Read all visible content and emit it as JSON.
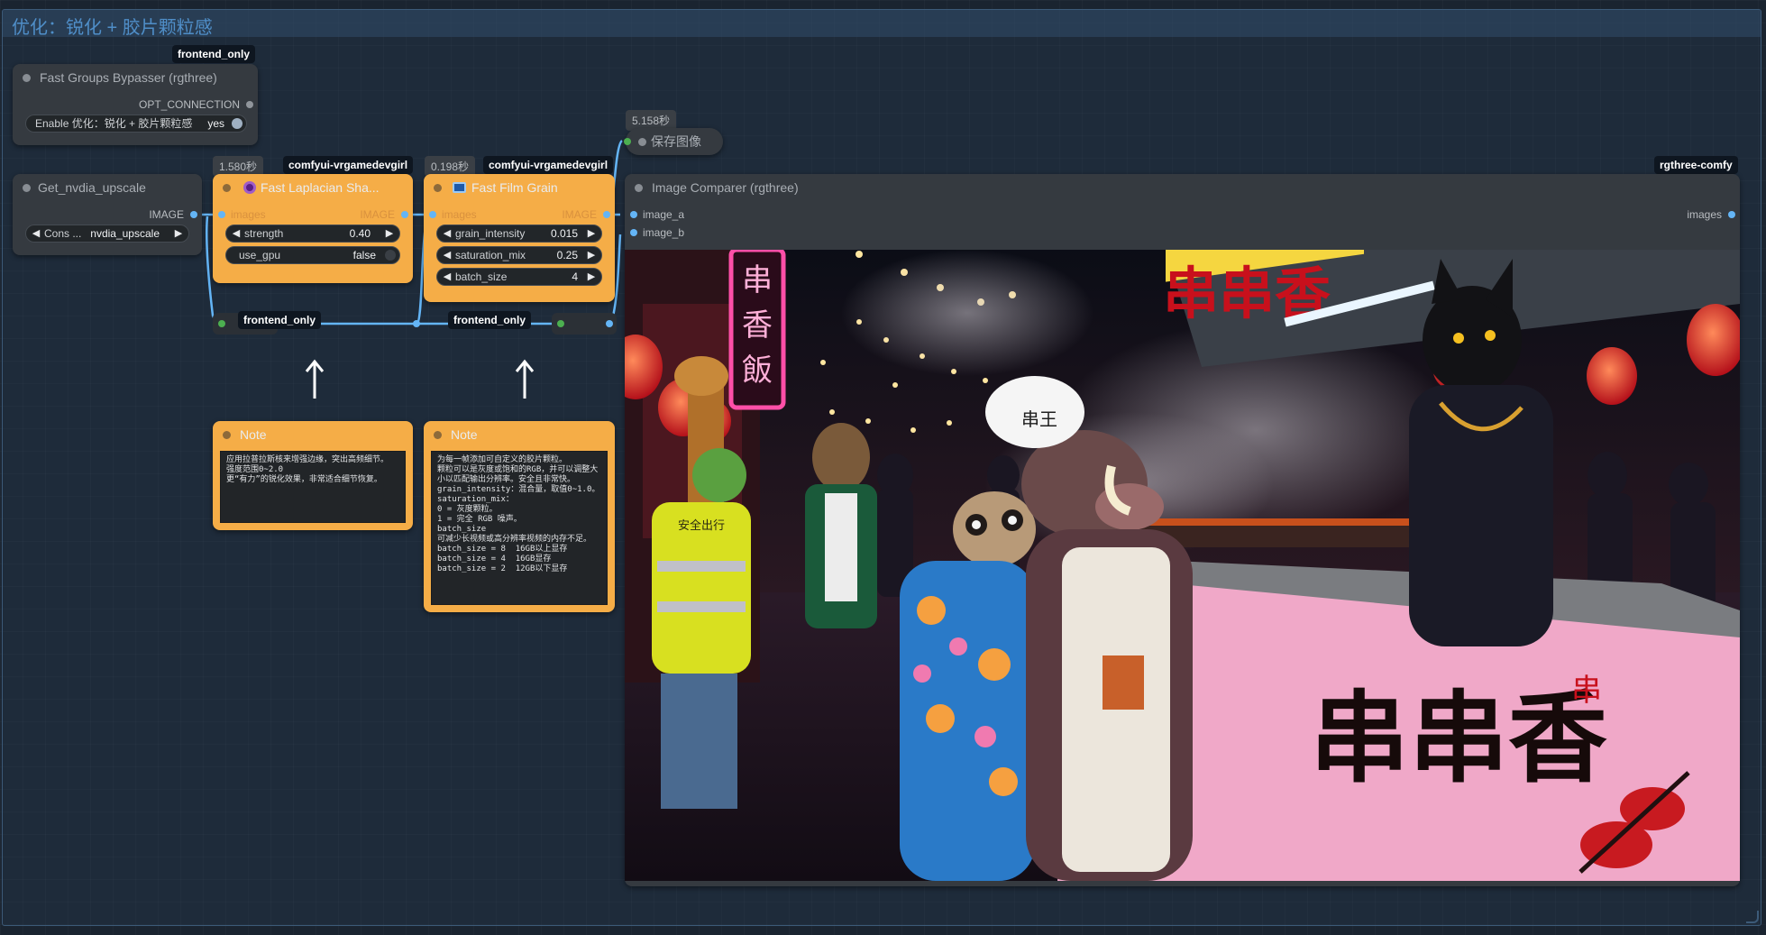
{
  "group": {
    "title": "优化：锐化 + 胶片颗粒感"
  },
  "badges": {
    "bypasser": "frontend_only",
    "laplacian_source": "comfyui-vrgamedevgirl",
    "laplacian_time": "1.580秒",
    "filmgrain_source": "comfyui-vrgamedevgirl",
    "filmgrain_time": "0.198秒",
    "save_time": "5.158秒",
    "comparer_source": "rgthree-comfy",
    "reroute_1": "frontend_only",
    "reroute_2": "frontend_only"
  },
  "bypasser": {
    "title": "Fast Groups Bypasser (rgthree)",
    "output": "OPT_CONNECTION",
    "toggle_label": "Enable 优化：锐化 + 胶片颗粒感",
    "toggle_value": "yes"
  },
  "get_upscale": {
    "title": "Get_nvdia_upscale",
    "output": "IMAGE",
    "combo_prefix": "Cons ...",
    "combo_value": "nvdia_upscale"
  },
  "laplacian": {
    "title": "Fast Laplacian Sha...",
    "input": "images",
    "output": "IMAGE",
    "strength_label": "strength",
    "strength_value": "0.40",
    "gpu_label": "use_gpu",
    "gpu_value": "false"
  },
  "filmgrain": {
    "title": "Fast Film Grain",
    "input": "images",
    "output": "IMAGE",
    "grain_label": "grain_intensity",
    "grain_value": "0.015",
    "sat_label": "saturation_mix",
    "sat_value": "0.25",
    "batch_label": "batch_size",
    "batch_value": "4"
  },
  "save_image": {
    "title": "保存图像"
  },
  "comparer": {
    "title": "Image Comparer (rgthree)",
    "input_a": "image_a",
    "input_b": "image_b",
    "output": "images"
  },
  "note1": {
    "title": "Note",
    "text": "应用拉普拉斯核来增强边缘，突出高频细节。\n强度范围0~2.0\n更“有力”的锐化效果，非常适合细节恢复。"
  },
  "note2": {
    "title": "Note",
    "text": "为每一帧添加可自定义的胶片颗粒。\n颗粒可以是灰度或饱和的RGB，并可以调整大小以匹配输出分辨率。安全且非常快。\ngrain_intensity：混合量，取值0~1.0。\nsaturation_mix：\n0 = 灰度颗粒。\n1 = 完全 RGB 噪声。\nbatch_size\n可减少长视频或高分辨率视频的内存不足。\nbatch_size = 8  16GB以上显存\nbatch_size = 4  16GB显存\nbatch_size = 2  12GB以下显存"
  },
  "scene": {
    "sign_left": "串香飯",
    "sign_top": "串串香",
    "sign_counter": "串串香",
    "sign_right": "串",
    "chef_hat": "串王",
    "vest": "安全出行"
  },
  "colors": {
    "link_blue": "#64b5f6",
    "node_orange": "#f5ad47",
    "node_dark": "#353a40",
    "group_title": "#4f8ec8"
  }
}
